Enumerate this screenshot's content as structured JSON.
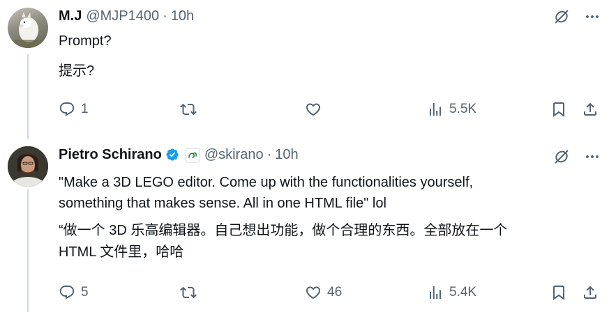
{
  "tweets": [
    {
      "name": "M.J",
      "handle": "@MJP1400",
      "separator": "·",
      "time": "10h",
      "lines": [
        "Prompt?",
        "提示?"
      ],
      "stats": {
        "replies": "1",
        "reposts": "",
        "likes": "",
        "views": "5.5K"
      }
    },
    {
      "name": "Pietro Schirano",
      "handle": "@skirano",
      "separator": "·",
      "time": "10h",
      "verified": true,
      "lines": [
        "\"Make a 3D LEGO editor. Come up with the functionalities yourself,",
        "something that makes sense. All in one HTML file\" lol",
        "“做一个 3D 乐高编辑器。自己想出功能，做个合理的东西。全部放在一个",
        "HTML 文件里，哈哈"
      ],
      "stats": {
        "replies": "5",
        "reposts": "",
        "likes": "46",
        "views": "5.4K"
      }
    }
  ],
  "icons": {
    "reply": "reply-icon",
    "repost": "repost-icon",
    "like": "heart-icon",
    "views": "views-icon",
    "bookmark": "bookmark-icon",
    "share": "share-icon",
    "grok": "grok-icon",
    "more": "more-icon"
  },
  "colors": {
    "text": "#0f1419",
    "secondary": "#536471",
    "verified": "#1d9bf0",
    "thread": "#cfd9de"
  }
}
